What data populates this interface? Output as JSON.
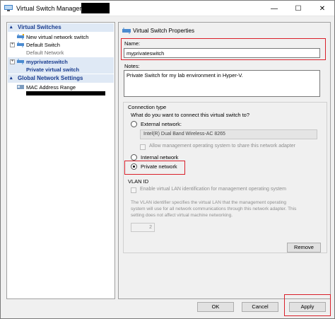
{
  "window": {
    "title": "Virtual Switch Manager for",
    "minimize_glyph": "—",
    "maximize_glyph": "☐",
    "close_glyph": "✕"
  },
  "sidebar": {
    "virtual_switches_header": "Virtual Switches",
    "items": [
      {
        "label": "New virtual network switch"
      },
      {
        "label": "Default Switch",
        "sublabel": "Default Network"
      },
      {
        "label": "myprivateswitch",
        "sublabel": "Private virtual switch"
      }
    ],
    "global_header": "Global Network Settings",
    "global_items": [
      {
        "label": "MAC Address Range"
      }
    ],
    "expander_plus": "+",
    "expander_minus": "−",
    "caret": "▴"
  },
  "properties": {
    "title": "Virtual Switch Properties",
    "name_label": "Name:",
    "name_value": "myprivateswitch",
    "notes_label": "Notes:",
    "notes_value": "Private Switch for my lab environment in Hyper-V.",
    "connection_type_label": "Connection type",
    "connection_question": "What do you want to connect this virtual switch to?",
    "external_label": "External network:",
    "adapter_value": "Intel(R) Dual Band Wireless-AC 8265",
    "allow_mgmt_label": "Allow management operating system to share this network adapter",
    "internal_label": "Internal network",
    "private_label": "Private network",
    "selected_connection": "Private network",
    "vlan_header": "VLAN ID",
    "vlan_enable_label": "Enable virtual LAN identification for management operating system",
    "vlan_desc_1": "The VLAN identifier specifies the virtual LAN that the management operating",
    "vlan_desc_2": "system will use for all network communications through this network adapter. This",
    "vlan_desc_3": "setting does not affect virtual machine networking.",
    "vlan_value": "2",
    "remove_label": "Remove"
  },
  "footer": {
    "ok_label": "OK",
    "cancel_label": "Cancel",
    "apply_label": "Apply"
  },
  "colors": {
    "highlight": "#d9202a",
    "section_header_bg": "#dfe9f5",
    "section_header_text": "#1a3d8f"
  }
}
